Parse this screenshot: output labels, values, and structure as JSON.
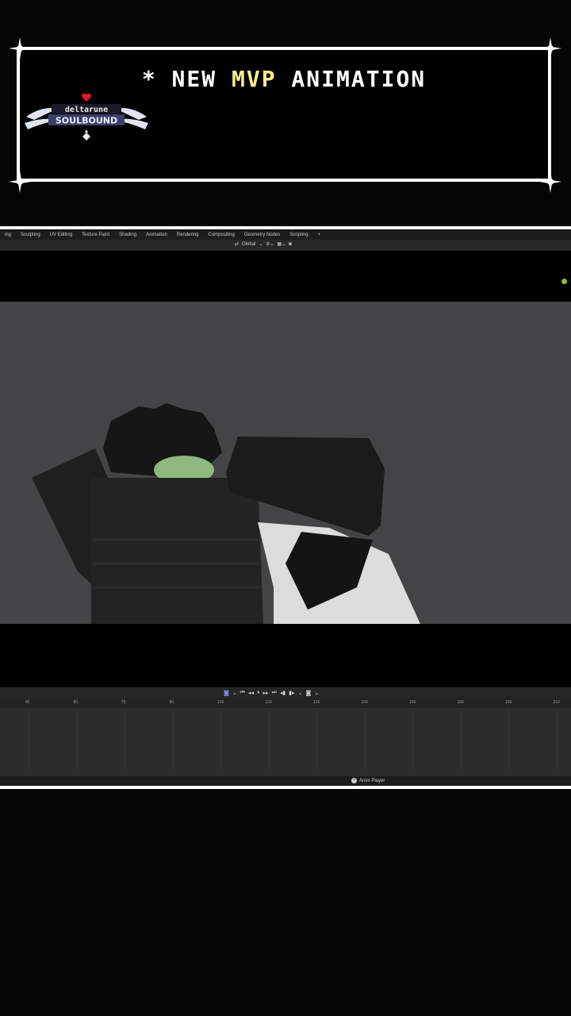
{
  "banner": {
    "prefix": "* NEW ",
    "highlight": "MVP",
    "suffix": " ANIMATION",
    "logo_top": "deltarune",
    "logo_bottom": "SOULBOUND"
  },
  "colors": {
    "highlight": "#f5f08c",
    "frame": "#ffffff",
    "viewport": "#444446"
  },
  "workspace_tabs": [
    "ing",
    "Sculpting",
    "UV Editing",
    "Texture Paint",
    "Shading",
    "Animation",
    "Rendering",
    "Compositing",
    "Geometry Nodes",
    "Scripting",
    "+"
  ],
  "header": {
    "orientation": "Global"
  },
  "timeline": {
    "ticks": [
      "45",
      "60",
      "75",
      "90",
      "105",
      "120",
      "135",
      "150",
      "165",
      "180",
      "195",
      "210"
    ]
  },
  "status": {
    "anim_player": "Anim Player"
  },
  "icons": [
    "heart-icon",
    "sparkle-corner-icon",
    "play-icon",
    "jump-start-icon",
    "jump-end-icon",
    "close-icon"
  ]
}
